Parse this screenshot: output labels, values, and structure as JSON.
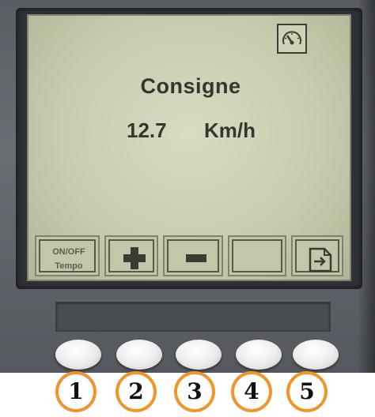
{
  "display": {
    "title": "Consigne",
    "value": "12.7",
    "unit": "Km/h",
    "status_icon": "speedometer-icon"
  },
  "softkeys": [
    {
      "id": 1,
      "line1": "ON/OFF",
      "line2": "Tempo",
      "icon": ""
    },
    {
      "id": 2,
      "line1": "",
      "line2": "",
      "icon": "plus-icon"
    },
    {
      "id": 3,
      "line1": "",
      "line2": "",
      "icon": "minus-icon"
    },
    {
      "id": 4,
      "line1": "",
      "line2": "",
      "icon": ""
    },
    {
      "id": 5,
      "line1": "",
      "line2": "",
      "icon": "page-next-icon"
    }
  ],
  "buttons": [
    {
      "number": "1"
    },
    {
      "number": "2"
    },
    {
      "number": "3"
    },
    {
      "number": "4"
    },
    {
      "number": "5"
    }
  ],
  "colors": {
    "lcd_background": "#c9ccaf",
    "lcd_text": "#35372f",
    "housing": "#5f6268",
    "badge_ring": "#f0952a"
  }
}
